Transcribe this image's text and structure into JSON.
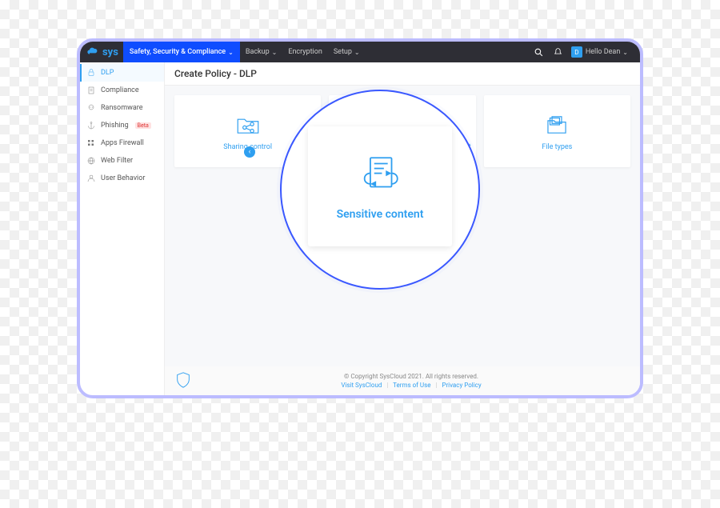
{
  "header": {
    "brand": "sys",
    "primary_tab": "Safety, Security & Compliance",
    "nav": [
      "Backup",
      "Encryption",
      "Setup"
    ],
    "user_initial": "D",
    "user_greeting": "Hello Dean"
  },
  "sidebar": {
    "items": [
      {
        "label": "DLP",
        "icon": "lock",
        "active": true
      },
      {
        "label": "Compliance",
        "icon": "doc"
      },
      {
        "label": "Ransomware",
        "icon": "skull"
      },
      {
        "label": "Phishing",
        "icon": "anchor",
        "badge": "Beta"
      },
      {
        "label": "Apps Firewall",
        "icon": "grid"
      },
      {
        "label": "Web Filter",
        "icon": "globe"
      },
      {
        "label": "User Behavior",
        "icon": "user"
      }
    ]
  },
  "page": {
    "title": "Create Policy - DLP",
    "cards": [
      {
        "label": "Sharing control",
        "icon": "share"
      },
      {
        "label": "Sensitive content",
        "icon": "sensitive"
      },
      {
        "label": "File types",
        "icon": "files"
      }
    ]
  },
  "magnifier": {
    "label": "Sensitive content"
  },
  "footer": {
    "copyright": "© Copyright SysCloud 2021. All rights reserved.",
    "links": [
      "Visit SysCloud",
      "Terms of Use",
      "Privacy Policy"
    ]
  }
}
